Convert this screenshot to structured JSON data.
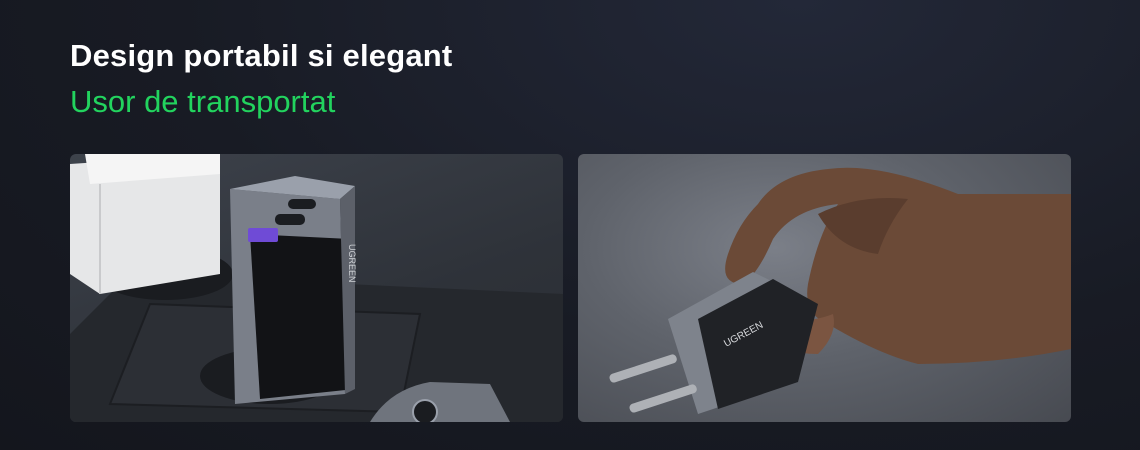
{
  "headline": "Design portabil si elegant",
  "subline": "Usor de transportat",
  "product": {
    "brand_mark": "UGREEN"
  },
  "colors": {
    "accent_green": "#22d35e",
    "background": "#181b24",
    "usb_a_port": "#6f4bd6"
  }
}
